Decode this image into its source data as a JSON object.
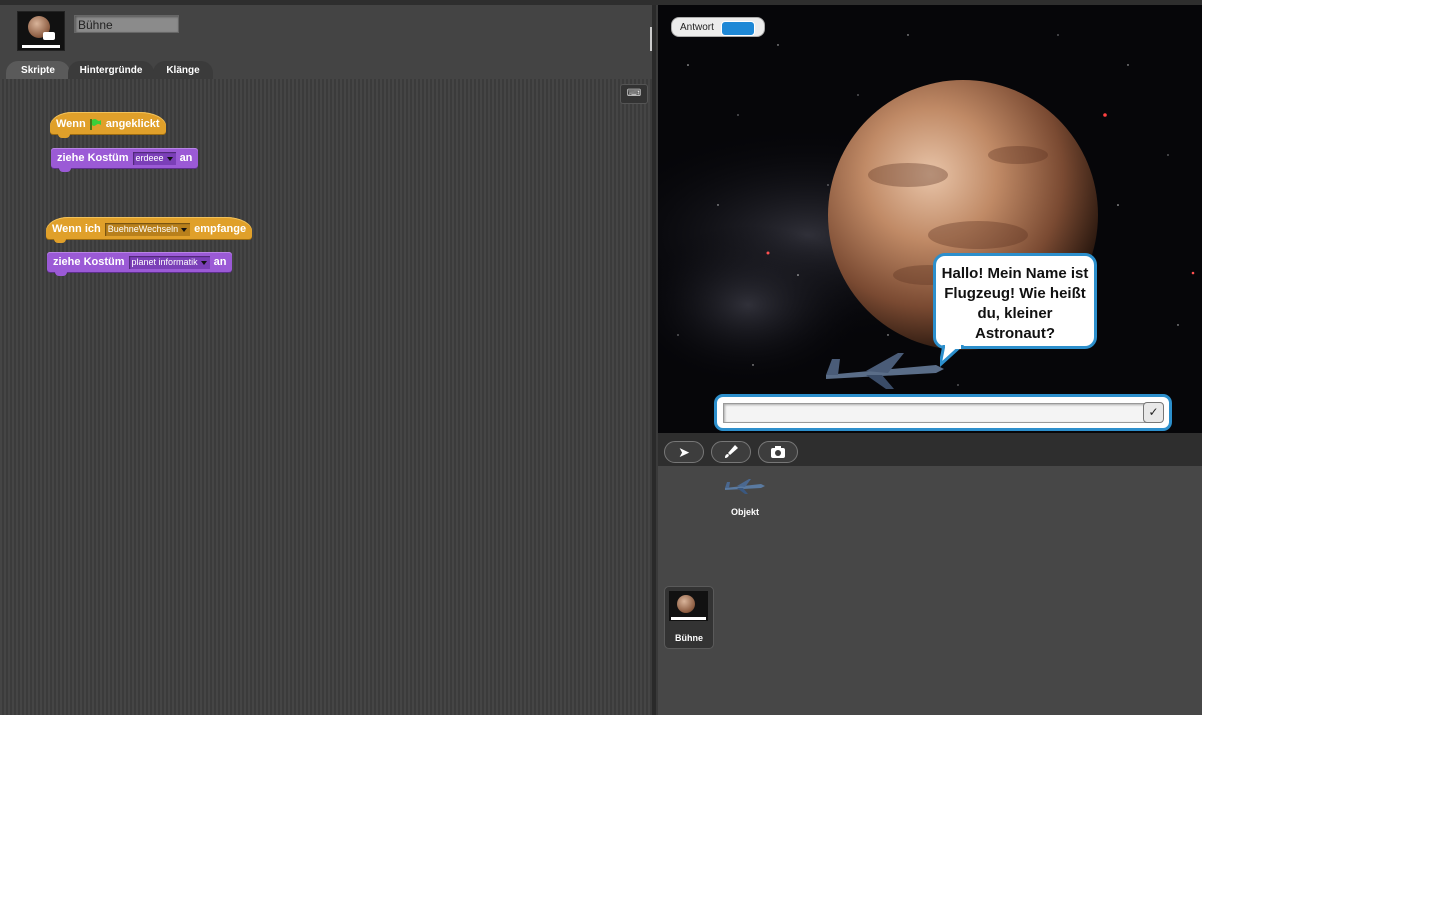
{
  "sprite_header": {
    "name_value": "Bühne"
  },
  "tabs": [
    {
      "label": "Skripte",
      "active": true
    },
    {
      "label": "Hintergründe",
      "active": false
    },
    {
      "label": "Klänge",
      "active": false
    }
  ],
  "scripts": [
    {
      "hat": {
        "word1": "Wenn",
        "flag_icon": "green-flag-icon",
        "word2": "angeklickt"
      },
      "command": {
        "word1": "ziehe",
        "word2": "Kostüm",
        "dropdown": "erdeee",
        "word3": "an"
      }
    },
    {
      "hat": {
        "word1": "Wenn",
        "word2": "ich",
        "dropdown": "BuehneWechseln",
        "word3": "empfange"
      },
      "command": {
        "word1": "ziehe",
        "word2": "Kostüm",
        "dropdown": "planet informatik",
        "word3": "an"
      }
    }
  ],
  "stage": {
    "watcher_label": "Antwort",
    "speech": "Hallo! Mein Name ist Flugzeug! Wie heißt du, kleiner Astronaut?",
    "ask_value": "",
    "ok_symbol": "✓"
  },
  "toolbar": {
    "icons": [
      "turtle-arrow-icon",
      "paintbrush-icon",
      "camera-icon"
    ],
    "arrow_glyph": "➤",
    "camera_glyph": "📷"
  },
  "corral": {
    "sprites": [
      {
        "name": "Objekt"
      }
    ],
    "stage_label": "Bühne"
  },
  "colors": {
    "control_hat": "#e0a02a",
    "looks_block": "#9b5ad6",
    "speech_border": "#2c8fcc",
    "watcher_value": "#1e88d6"
  }
}
